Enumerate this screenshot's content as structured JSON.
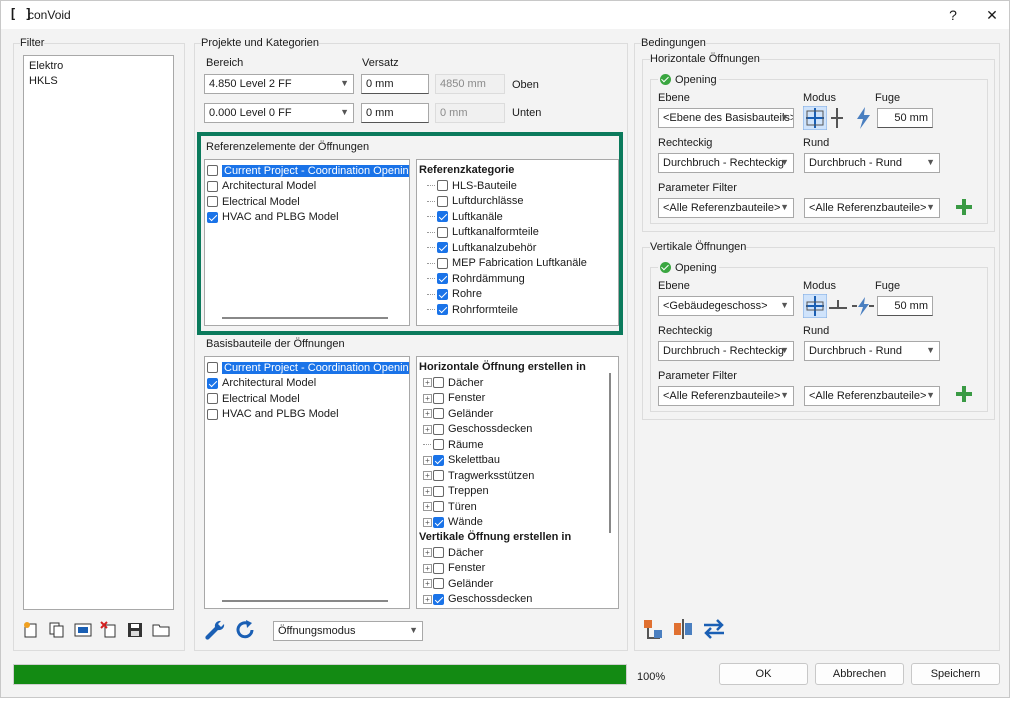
{
  "window": {
    "title": "conVoid",
    "app_icon": "[ ]",
    "help": "?",
    "close": "✕"
  },
  "filter": {
    "group_label": "Filter",
    "items": [
      "Elektro",
      "HKLS"
    ]
  },
  "projects": {
    "group_label": "Projekte und Kategorien",
    "bereich_label": "Bereich",
    "versatz_label": "Versatz",
    "top": {
      "level": "4.850  Level 2 FF",
      "offset": "0 mm",
      "computed": "4850 mm",
      "side": "Oben"
    },
    "bottom": {
      "level": "0.000  Level 0 FF",
      "offset": "0 mm",
      "computed": "0 mm",
      "side": "Unten"
    }
  },
  "references": {
    "group_label": "Referenzelemente der Öffnungen",
    "models": [
      {
        "label": "Current Project - Coordination Openings",
        "checked": false,
        "selected": true
      },
      {
        "label": "Architectural Model",
        "checked": false,
        "selected": false
      },
      {
        "label": "Electrical Model",
        "checked": false,
        "selected": false
      },
      {
        "label": "HVAC and PLBG Model",
        "checked": true,
        "selected": false
      }
    ],
    "category_header": "Referenzkategorie",
    "categories": [
      {
        "label": "HLS-Bauteile",
        "checked": false
      },
      {
        "label": "Luftdurchlässe",
        "checked": false
      },
      {
        "label": "Luftkanäle",
        "checked": true
      },
      {
        "label": "Luftkanalformteile",
        "checked": false
      },
      {
        "label": "Luftkanalzubehör",
        "checked": true
      },
      {
        "label": "MEP Fabrication Luftkanäle",
        "checked": false
      },
      {
        "label": "Rohrdämmung",
        "checked": true
      },
      {
        "label": "Rohre",
        "checked": true
      },
      {
        "label": "Rohrformteile",
        "checked": true
      }
    ]
  },
  "base": {
    "group_label": "Basisbauteile der Öffnungen",
    "models": [
      {
        "label": "Current Project - Coordination Openings",
        "checked": false,
        "selected": true
      },
      {
        "label": "Architectural Model",
        "checked": true,
        "selected": false
      },
      {
        "label": "Electrical Model",
        "checked": false,
        "selected": false
      },
      {
        "label": "HVAC and PLBG Model",
        "checked": false,
        "selected": false
      }
    ],
    "horizontal_header": "Horizontale Öffnung erstellen in",
    "horizontal": [
      {
        "label": "Dächer",
        "checked": false,
        "expand": true
      },
      {
        "label": "Fenster",
        "checked": false,
        "expand": true
      },
      {
        "label": "Geländer",
        "checked": false,
        "expand": true
      },
      {
        "label": "Geschossdecken",
        "checked": false,
        "expand": true
      },
      {
        "label": "Räume",
        "checked": false,
        "expand": false
      },
      {
        "label": "Skelettbau",
        "checked": true,
        "expand": true
      },
      {
        "label": "Tragwerksstützen",
        "checked": false,
        "expand": true
      },
      {
        "label": "Treppen",
        "checked": false,
        "expand": true
      },
      {
        "label": "Türen",
        "checked": false,
        "expand": true
      },
      {
        "label": "Wände",
        "checked": true,
        "expand": true
      }
    ],
    "vertical_header": "Vertikale Öffnung erstellen in",
    "vertical": [
      {
        "label": "Dächer",
        "checked": false,
        "expand": true
      },
      {
        "label": "Fenster",
        "checked": false,
        "expand": true
      },
      {
        "label": "Geländer",
        "checked": false,
        "expand": true
      },
      {
        "label": "Geschossdecken",
        "checked": true,
        "expand": true
      }
    ],
    "mode_select": "Öffnungsmodus"
  },
  "conditions": {
    "group_label": "Bedingungen",
    "horizontal": {
      "group_label": "Horizontale Öffnungen",
      "opening_label": "Opening",
      "ebene_label": "Ebene",
      "modus_label": "Modus",
      "fuge_label": "Fuge",
      "ebene_value": "<Ebene des Basisbauteils>",
      "fuge_value": "50 mm",
      "rechteckig_label": "Rechteckig",
      "rund_label": "Rund",
      "rechteckig_value": "Durchbruch - Rechteckig",
      "rund_value": "Durchbruch - Rund",
      "param_label": "Parameter Filter",
      "param_a": "<Alle Referenzbauteile>",
      "param_b": "<Alle Referenzbauteile>"
    },
    "vertical": {
      "group_label": "Vertikale Öffnungen",
      "opening_label": "Opening",
      "ebene_label": "Ebene",
      "modus_label": "Modus",
      "fuge_label": "Fuge",
      "ebene_value": "<Gebäudegeschoss>",
      "fuge_value": "50 mm",
      "rechteckig_label": "Rechteckig",
      "rund_label": "Rund",
      "rechteckig_value": "Durchbruch - Rechteckig",
      "rund_value": "Durchbruch - Rund",
      "param_label": "Parameter Filter",
      "param_a": "<Alle Referenzbauteile>",
      "param_b": "<Alle Referenzbauteile>"
    }
  },
  "footer": {
    "progress": 1.0,
    "progress_text": "100%",
    "ok": "OK",
    "cancel": "Abbrechen",
    "save": "Speichern"
  },
  "colors": {
    "accent": "#1a73e8",
    "highlight_border": "#0b7a5c",
    "progress": "#138a13",
    "add": "#3a9a44"
  }
}
